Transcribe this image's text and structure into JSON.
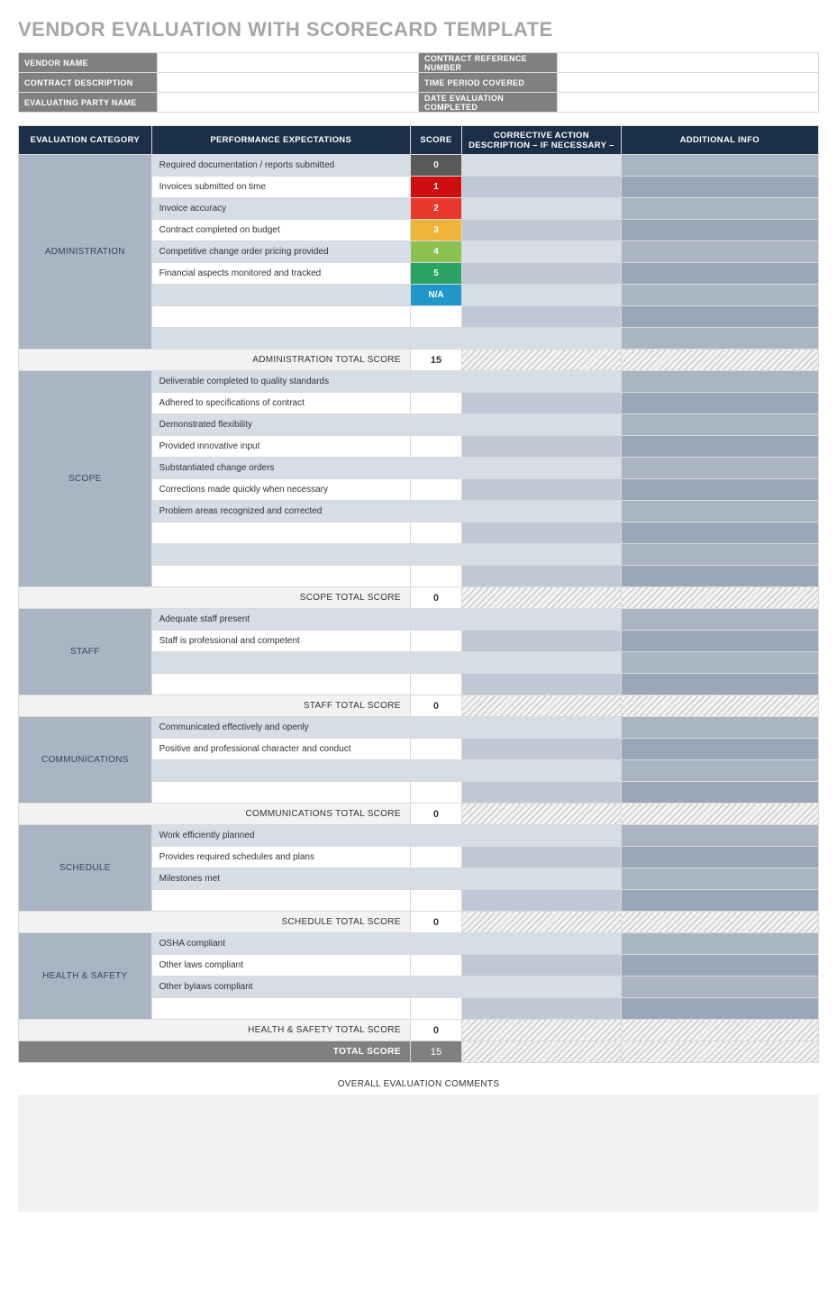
{
  "title": "VENDOR EVALUATION WITH SCORECARD TEMPLATE",
  "info": {
    "rows": [
      {
        "l": "VENDOR NAME",
        "v": "",
        "r": "CONTRACT REFERENCE NUMBER",
        "rv": ""
      },
      {
        "l": "CONTRACT DESCRIPTION",
        "v": "",
        "r": "TIME PERIOD COVERED",
        "rv": ""
      },
      {
        "l": "EVALUATING PARTY NAME",
        "v": "",
        "r": "DATE EVALUATION COMPLETED",
        "rv": ""
      }
    ]
  },
  "headers": {
    "category": "EVALUATION CATEGORY",
    "perf": "PERFORMANCE EXPECTATIONS",
    "score": "SCORE",
    "corr": "CORRECTIVE ACTION DESCRIPTION – IF NECESSARY –",
    "add": "ADDITIONAL INFO"
  },
  "scoreColors": {
    "0": "#595959",
    "1": "#cf0e10",
    "2": "#e7382b",
    "3": "#f1b43a",
    "4": "#8cc152",
    "5": "#2ba264",
    "NA": "#2196c8",
    "NA_label": "N/A"
  },
  "sections": [
    {
      "name": "ADMINISTRATION",
      "rows": [
        {
          "perf": "Required documentation / reports submitted",
          "score": "0",
          "scoreKey": "0"
        },
        {
          "perf": "Invoices submitted on time",
          "score": "1",
          "scoreKey": "1"
        },
        {
          "perf": "Invoice accuracy",
          "score": "2",
          "scoreKey": "2"
        },
        {
          "perf": "Contract completed on budget",
          "score": "3",
          "scoreKey": "3"
        },
        {
          "perf": "Competitive change order pricing provided",
          "score": "4",
          "scoreKey": "4"
        },
        {
          "perf": "Financial aspects monitored and tracked",
          "score": "5",
          "scoreKey": "5"
        },
        {
          "perf": "",
          "score": "N/A",
          "scoreKey": "NA"
        },
        {
          "perf": "",
          "score": "",
          "scoreKey": ""
        },
        {
          "perf": "",
          "score": "",
          "scoreKey": ""
        }
      ],
      "totalLabel": "ADMINISTRATION TOTAL SCORE",
      "totalValue": "15"
    },
    {
      "name": "SCOPE",
      "rows": [
        {
          "perf": "Deliverable completed to quality standards",
          "score": "",
          "scoreKey": ""
        },
        {
          "perf": "Adhered to specifications of contract",
          "score": "",
          "scoreKey": ""
        },
        {
          "perf": "Demonstrated flexibility",
          "score": "",
          "scoreKey": ""
        },
        {
          "perf": "Provided innovative input",
          "score": "",
          "scoreKey": ""
        },
        {
          "perf": "Substantiated change orders",
          "score": "",
          "scoreKey": ""
        },
        {
          "perf": "Corrections made quickly when necessary",
          "score": "",
          "scoreKey": ""
        },
        {
          "perf": "Problem areas recognized and corrected",
          "score": "",
          "scoreKey": ""
        },
        {
          "perf": "",
          "score": "",
          "scoreKey": ""
        },
        {
          "perf": "",
          "score": "",
          "scoreKey": ""
        },
        {
          "perf": "",
          "score": "",
          "scoreKey": ""
        }
      ],
      "totalLabel": "SCOPE TOTAL SCORE",
      "totalValue": "0"
    },
    {
      "name": "STAFF",
      "rows": [
        {
          "perf": "Adequate staff present",
          "score": "",
          "scoreKey": ""
        },
        {
          "perf": "Staff is professional and competent",
          "score": "",
          "scoreKey": ""
        },
        {
          "perf": "",
          "score": "",
          "scoreKey": ""
        },
        {
          "perf": "",
          "score": "",
          "scoreKey": ""
        }
      ],
      "totalLabel": "STAFF TOTAL SCORE",
      "totalValue": "0"
    },
    {
      "name": "COMMUNICATIONS",
      "rows": [
        {
          "perf": "Communicated effectively and openly",
          "score": "",
          "scoreKey": ""
        },
        {
          "perf": "Positive and professional character and conduct",
          "score": "",
          "scoreKey": ""
        },
        {
          "perf": "",
          "score": "",
          "scoreKey": ""
        },
        {
          "perf": "",
          "score": "",
          "scoreKey": ""
        }
      ],
      "totalLabel": "COMMUNICATIONS TOTAL SCORE",
      "totalValue": "0"
    },
    {
      "name": "SCHEDULE",
      "rows": [
        {
          "perf": "Work efficiently planned",
          "score": "",
          "scoreKey": ""
        },
        {
          "perf": "Provides required schedules and plans",
          "score": "",
          "scoreKey": ""
        },
        {
          "perf": "Milestones met",
          "score": "",
          "scoreKey": ""
        },
        {
          "perf": "",
          "score": "",
          "scoreKey": ""
        }
      ],
      "totalLabel": "SCHEDULE TOTAL SCORE",
      "totalValue": "0"
    },
    {
      "name": "HEALTH & SAFETY",
      "rows": [
        {
          "perf": "OSHA compliant",
          "score": "",
          "scoreKey": ""
        },
        {
          "perf": "Other laws compliant",
          "score": "",
          "scoreKey": ""
        },
        {
          "perf": "Other bylaws compliant",
          "score": "",
          "scoreKey": ""
        },
        {
          "perf": "",
          "score": "",
          "scoreKey": ""
        }
      ],
      "totalLabel": "HEALTH & SAFETY TOTAL SCORE",
      "totalValue": "0"
    }
  ],
  "grand": {
    "label": "TOTAL SCORE",
    "value": "15"
  },
  "comments": {
    "label": "OVERALL EVALUATION COMMENTS",
    "value": ""
  }
}
